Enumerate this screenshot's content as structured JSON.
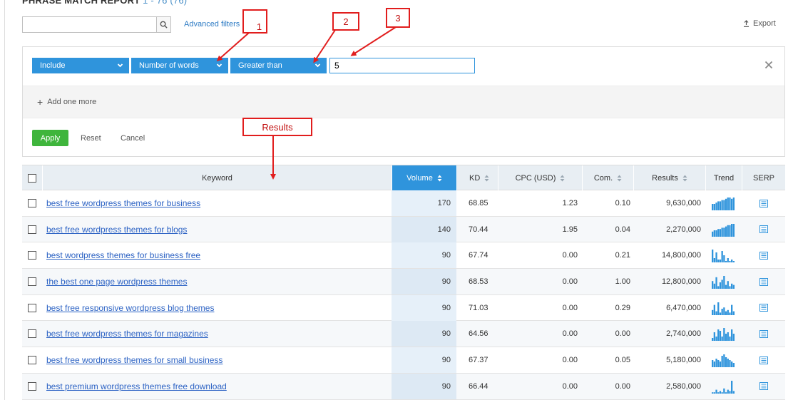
{
  "header": {
    "title": "PHRASE MATCH REPORT",
    "count": "1 - 76 (76)",
    "search_placeholder": "",
    "advanced_filters": "Advanced filters",
    "export": "Export"
  },
  "filter": {
    "include": "Include",
    "field": "Number of words",
    "operator": "Greater than",
    "value": "5",
    "add_one_more": "Add one more",
    "apply": "Apply",
    "reset": "Reset",
    "cancel": "Cancel"
  },
  "annotations": {
    "one": "1",
    "two": "2",
    "three": "3",
    "results": "Results"
  },
  "table": {
    "columns": [
      "Keyword",
      "Volume",
      "KD",
      "CPC (USD)",
      "Com.",
      "Results",
      "Trend",
      "SERP"
    ],
    "rows": [
      {
        "keyword": "best free wordpress themes for business",
        "volume": "170",
        "kd": "68.85",
        "cpc": "1.23",
        "com": "0.10",
        "results": "9,630,000",
        "trend": [
          5,
          5,
          6,
          7,
          7,
          8,
          8,
          9,
          10,
          10,
          9,
          10
        ]
      },
      {
        "keyword": "best free wordpress themes for blogs",
        "volume": "140",
        "kd": "70.44",
        "cpc": "1.95",
        "com": "0.04",
        "results": "2,270,000",
        "trend": [
          4,
          5,
          5,
          6,
          6,
          7,
          7,
          8,
          9,
          9,
          10,
          10
        ]
      },
      {
        "keyword": "best wordpress themes for business free",
        "volume": "90",
        "kd": "67.74",
        "cpc": "0.00",
        "com": "0.21",
        "results": "14,800,000",
        "trend": [
          9,
          3,
          7,
          2,
          2,
          8,
          5,
          1,
          3,
          1,
          2,
          1
        ]
      },
      {
        "keyword": "the best one page wordpress themes",
        "volume": "90",
        "kd": "68.53",
        "cpc": "0.00",
        "com": "1.00",
        "results": "12,800,000",
        "trend": [
          6,
          4,
          9,
          2,
          5,
          7,
          10,
          3,
          6,
          2,
          4,
          3
        ]
      },
      {
        "keyword": "best free responsive wordpress blog themes",
        "volume": "90",
        "kd": "71.03",
        "cpc": "0.00",
        "com": "0.29",
        "results": "6,470,000",
        "trend": [
          4,
          8,
          3,
          10,
          2,
          5,
          6,
          3,
          4,
          2,
          8,
          3
        ]
      },
      {
        "keyword": "best free wordpress themes for magazines",
        "volume": "90",
        "kd": "64.56",
        "cpc": "0.00",
        "com": "0.00",
        "results": "2,740,000",
        "trend": [
          2,
          6,
          3,
          8,
          7,
          3,
          9,
          5,
          6,
          3,
          8,
          5
        ]
      },
      {
        "keyword": "best free wordpress themes for small business",
        "volume": "90",
        "kd": "67.37",
        "cpc": "0.00",
        "com": "0.05",
        "results": "5,180,000",
        "trend": [
          5,
          4,
          6,
          5,
          4,
          8,
          9,
          7,
          6,
          5,
          4,
          3
        ]
      },
      {
        "keyword": "best premium wordpress themes free download",
        "volume": "90",
        "kd": "66.44",
        "cpc": "0.00",
        "com": "0.00",
        "results": "2,580,000",
        "trend": [
          1,
          1,
          3,
          1,
          2,
          1,
          4,
          1,
          3,
          2,
          10,
          2
        ]
      }
    ]
  },
  "colors": {
    "accent": "#2f94dc",
    "apply": "#3fb53c",
    "link": "#2d63c4",
    "annotation": "#e11d1d",
    "trend": "#2f94dc"
  }
}
